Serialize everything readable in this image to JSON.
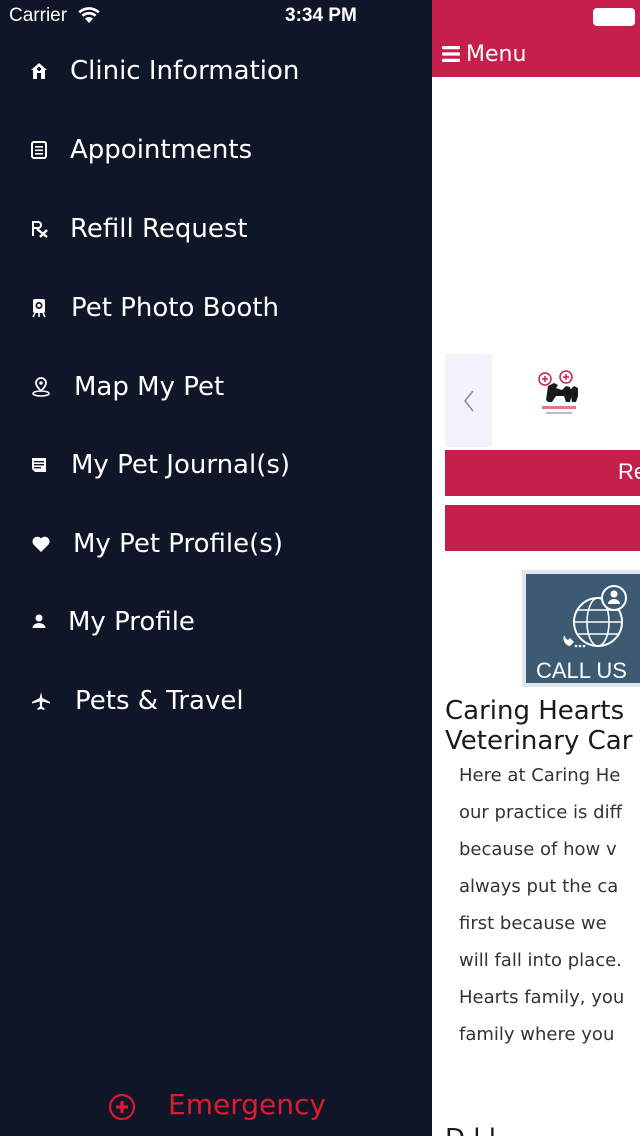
{
  "status_bar": {
    "carrier": "Carrier",
    "time": "3:34 PM",
    "wifi_icon": "wifi-icon",
    "battery_icon": "battery-icon"
  },
  "drawer": {
    "items": [
      {
        "label": "Clinic Information",
        "icon": "home-icon"
      },
      {
        "label": "Appointments",
        "icon": "list-icon"
      },
      {
        "label": "Refill Request",
        "icon": "rx-icon"
      },
      {
        "label": "Pet Photo Booth",
        "icon": "camera-icon"
      },
      {
        "label": "Map My Pet",
        "icon": "map-pin-icon"
      },
      {
        "label": "My Pet Journal(s)",
        "icon": "journal-icon"
      },
      {
        "label": "My Pet Profile(s)",
        "icon": "heart-icon"
      },
      {
        "label": "My Profile",
        "icon": "user-icon"
      },
      {
        "label": "Pets & Travel",
        "icon": "airplane-icon"
      }
    ],
    "emergency": {
      "label": "Emergency",
      "icon": "plus-circle-icon",
      "color": "#e01931"
    }
  },
  "main": {
    "header": {
      "menu_label": "Menu",
      "menu_icon": "hamburger-icon",
      "color": "#c5204b"
    },
    "carousel": {
      "prev_icon": "chevron-left-icon",
      "logo_icon": "caring-hearts-logo"
    },
    "buttons": [
      {
        "label": "Re"
      },
      {
        "label": ""
      }
    ],
    "call_us": {
      "label": "CALL US",
      "icon": "globe-phone-icon"
    },
    "about": {
      "title_lines": [
        "Caring Hearts",
        "Veterinary Car"
      ],
      "body_lines": [
        "Here at Caring He",
        "our practice is diff",
        "because of how v",
        "always put the ca",
        "first because we",
        "will fall into place.",
        "Hearts family, you",
        "family where you"
      ]
    },
    "bottom_heading": "D  l  l"
  },
  "colors": {
    "drawer_bg": "#0f1628",
    "accent": "#c5204b",
    "emergency": "#e01931",
    "call_us_bg": "#3c5a72"
  }
}
